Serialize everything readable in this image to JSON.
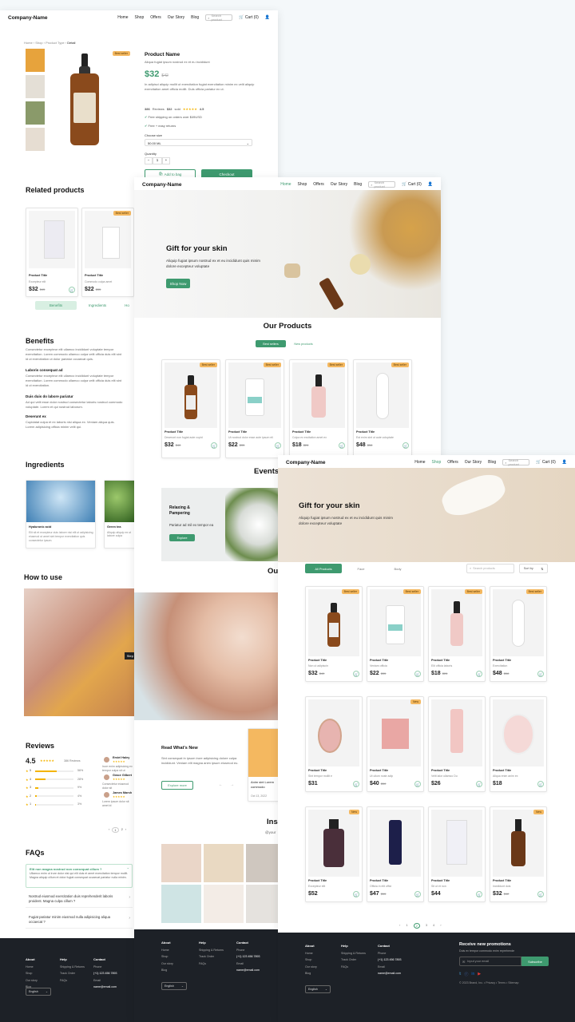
{
  "colors": {
    "accent": "#3e9a6f",
    "badge": "#f4b860",
    "footer": "#1d2127"
  },
  "nav": {
    "logo": "Company-Name",
    "links": [
      "Home",
      "Shop",
      "Offers",
      "Our Story",
      "Blog"
    ],
    "search_placeholder": "Search product",
    "cart": "Cart (0)",
    "cart_icon": "cart-icon",
    "user_icon": "user-icon",
    "search_icon": "search-icon"
  },
  "detail": {
    "breadcrumb": [
      "Home",
      "Shop",
      "Product Type",
      "Detail"
    ],
    "badge": "Best seller",
    "name": "Product Name",
    "subtitle": "Aliqua fugiat ipsum nostrud ex et eu incididunt",
    "price": "$32",
    "old_price": "$42",
    "description": "In adlpisci aliquip mollit ut exercitation fugiat exercitation minim ex velit aliquip exercitation amet officia mollit. Duis officia pariatur ex ut.",
    "stats": [
      "386",
      "Reviews",
      "$32",
      "sold",
      "4.5"
    ],
    "perks": [
      "Free shipping on orders over $49USD",
      "Free + easy returns"
    ],
    "choose_size_label": "Choose size",
    "size_value": "50.00 ML",
    "quantity_label": "Quantity",
    "quantity": "1",
    "add_to_bag": "Add to bag",
    "checkout": "Checkout"
  },
  "related": {
    "title": "Related products",
    "cards": [
      {
        "title": "Product Title",
        "sub": "Excepteur elit",
        "price": "$32",
        "old": "$45"
      },
      {
        "title": "Product Title",
        "sub": "Commodo culpa amet",
        "price": "$22",
        "old": "$35",
        "badge": "Best seller"
      }
    ],
    "tabs": [
      "Benefits",
      "Ingredients",
      "Ho"
    ]
  },
  "benefits": {
    "title": "Benefits",
    "intro": "Consectetur excepteur elit ullamco incididunt voluptate tempor exercitation. Lorem commodo ullamco culpa velit officia duis elit sint id ut exercitation ut dolor pariatur occaecat quis.",
    "items": [
      {
        "h": "Laboris consequat ad",
        "t": "Consectetur excepteur elit ullamco incididunt voluptate tempor exercitation. Lorem commodo ullamco culpa velit officia duis elit sint id ut exercitation."
      },
      {
        "h": "Duis duis do labore pariatur",
        "t": "Ad qui velit esse dolor nostrud consectetur laboris nostrud commodo voluptate. Lorem et qui nostrud laborum."
      },
      {
        "h": "Deserunt ex",
        "t": "Cupidatat culpa et ex laboris nisi aliqua ex. Veniam aliqua quis. Lorem adipisicing officia minim velit qui."
      }
    ]
  },
  "ingredients": {
    "title": "Ingredients",
    "items": [
      {
        "name": "Hyaluronic acid",
        "desc": "Elit sit et excepteur duis labore nisi elit ut adipisicing eiusmod ut amet sint tempor exercitation quis consectetur ipsum."
      },
      {
        "name": "Green tea",
        "desc": "Aliquip aliquip ex ut labore culpa"
      }
    ]
  },
  "howto": {
    "title": "How to use",
    "step": "Step"
  },
  "reviews": {
    "title": "Reviews",
    "score": "4.5",
    "count": "386 Reviews",
    "bars": [
      {
        "label": "5",
        "pct": "56%",
        "fill": 0.56
      },
      {
        "label": "4",
        "pct": "28%",
        "fill": 0.28
      },
      {
        "label": "3",
        "pct": "9%",
        "fill": 0.09
      },
      {
        "label": "2",
        "pct": "4%",
        "fill": 0.04
      },
      {
        "label": "1",
        "pct": "3%",
        "fill": 0.03
      }
    ],
    "people": [
      {
        "name": "Emiel Haley",
        "text": "Irure enim adipisicing ex tempor culpa sit ut"
      },
      {
        "name": "Grace Gilbert",
        "text": "Consectetur eiusmod dolor sit"
      },
      {
        "name": "James Marsh",
        "text": "Lorem ipsum dolor sit amet id"
      }
    ],
    "pages": [
      "‹",
      "1",
      "2",
      "›"
    ]
  },
  "faqs": {
    "title": "FAQs",
    "items": [
      {
        "q": "Elit non magna nostrud non consequat cillum ?",
        "a": "Ullamco enim ut irure dolor nisi qui elit duis et amet exercitation tempor mollit. Magna aliquip cillum et dolor fugiat consequat occaecat pariatur nulla minim.",
        "open": true
      },
      {
        "q": "Nostrud eiusmod exercitation duis reprehenderit laboris proident. Magna culpa cillum ?",
        "open": false
      },
      {
        "q": "Fugiat pariatur minim eiusmod nulla adipisicing aliqua occaecat ?",
        "open": false
      }
    ]
  },
  "footer": {
    "cols": [
      {
        "h": "About",
        "items": [
          "Home",
          "Shop",
          "Our story",
          "Blog"
        ]
      },
      {
        "h": "Help",
        "items": [
          "Shipping & Returns",
          "Track Order",
          "FAQs"
        ]
      },
      {
        "h": "Contact",
        "items": [
          "Phone",
          "(+1) 123 456 7893",
          "Email",
          "name@email.com"
        ]
      }
    ],
    "language": "English",
    "newsletter_title": "Receive new promotions",
    "newsletter_sub": "Duis ex tempor commodo enim reprehende",
    "email_placeholder": "Input your email",
    "subscribe": "Subscribe",
    "copyright": "© 2023 Brand, Inc.  •  Privacy  •  Terms  •  Sitemap"
  },
  "home": {
    "hero_title": "Gift for your skin",
    "hero_text": "Aliquip fugiat ipsum nostrud ex et eu incididunt quis minim dolore excepteur voluptate",
    "shop_now": "Shop Now",
    "products_title": "Our Products",
    "tabs": [
      "Best sellers",
      "New products"
    ],
    "products": [
      {
        "title": "Product Title",
        "sub": "Deserunt non fugiat aute cupid",
        "price": "$32",
        "old": "$40"
      },
      {
        "title": "Product Title",
        "sub": "Ut nostrud dolor esse aute ipsum eli",
        "price": "$22",
        "old": "$35"
      },
      {
        "title": "Product Title",
        "sub": "Culpa ex excitation amet ex",
        "price": "$18",
        "old": "$28"
      },
      {
        "title": "Product Title",
        "sub": "Est enim sint ut aute voluptate",
        "price": "$48",
        "old": "$58"
      }
    ],
    "events_title": "Events",
    "event": {
      "title": "Relaxing & Pampering",
      "text": "Pariatur ad mil ex tempor ea",
      "btn": "Explore"
    },
    "ou_title": "Ou",
    "blog": {
      "title": "Read What's New",
      "text": "Sint consequat in ipsum irure adipisicing dolore culpa incididunt. Veniam elit magna anim ipsum eiusmod eu.",
      "btn": "Explore more",
      "card": "Anim sint Lorem commodo",
      "date": "Oct 13, 2022"
    },
    "insta_title": "Ins",
    "insta_handle": "@your"
  },
  "shop": {
    "hero_title": "Gift for your skin",
    "hero_text": "Aliquip fugiat ipsum nostrud ex et eu incididunt quis minim dolore excepteur voluptate",
    "filters": [
      "All Products",
      "Face",
      "Body"
    ],
    "search_placeholder": "Search products",
    "sort": "Sort by",
    "rows": [
      [
        {
          "title": "Product Title",
          "sub": "Non ut adipiscin",
          "price": "$32",
          "old": "$40",
          "badge": "Best seller"
        },
        {
          "title": "Product Title",
          "sub": "Veniam officia",
          "price": "$22",
          "old": "$35",
          "badge": "Best seller"
        },
        {
          "title": "Product Title",
          "sub": "Elit officia laboris",
          "price": "$18",
          "old": "$28",
          "badge": "Best seller"
        },
        {
          "title": "Product Title",
          "sub": "Exercitation",
          "price": "$48",
          "old": "$58",
          "badge": "Best seller"
        }
      ],
      [
        {
          "title": "Product Title",
          "sub": "Sint tempor mollit e",
          "price": "$31",
          "old": ""
        },
        {
          "title": "Product Title",
          "sub": "Ut ullum nostr adip",
          "price": "$40",
          "old": "$50",
          "badge": "New"
        },
        {
          "title": "Product Title",
          "sub": "Velit lalor ullamco Du",
          "price": "$26",
          "old": ""
        },
        {
          "title": "Product Title",
          "sub": "Aliqua enim anim ex",
          "price": "$18",
          "old": ""
        }
      ],
      [
        {
          "title": "Product Title",
          "sub": "Excepteur elit",
          "price": "$52",
          "old": "",
          "badge": "New"
        },
        {
          "title": "Product Title",
          "sub": "Officia in elit offici",
          "price": "$47",
          "old": "$55"
        },
        {
          "title": "Product Title",
          "sub": "Sit ut et non",
          "price": "$44",
          "old": ""
        },
        {
          "title": "Product Title",
          "sub": "Incididunt duis",
          "price": "$32",
          "old": "$42",
          "badge": "New"
        }
      ]
    ],
    "pages": [
      "‹",
      "1",
      "2",
      "3",
      "4",
      "›"
    ]
  }
}
